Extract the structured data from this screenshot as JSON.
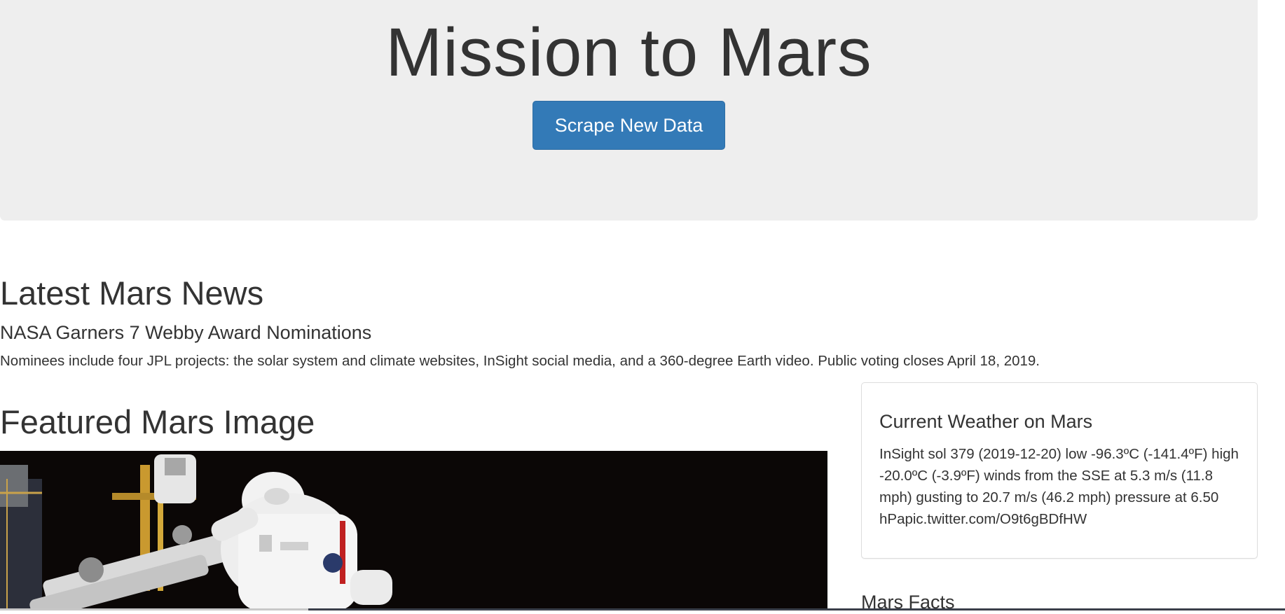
{
  "header": {
    "title": "Mission to Mars",
    "scrape_button_label": "Scrape New Data",
    "button_color": "#337ab7"
  },
  "news": {
    "heading": "Latest Mars News",
    "title": "NASA Garners 7 Webby Award Nominations",
    "paragraph": "Nominees include four JPL projects: the solar system and climate websites, InSight social media, and a 360-degree Earth video. Public voting closes April 18, 2019."
  },
  "featured": {
    "heading": "Featured Mars Image",
    "image_alt": "astronaut-spacewalk-image"
  },
  "weather": {
    "title": "Current Weather on Mars",
    "text": "InSight sol 379 (2019-12-20) low -96.3ºC (-141.4ºF) high -20.0ºC (-3.9ºF) winds from the SSE at 5.3 m/s (11.8 mph) gusting to 20.7 m/s (46.2 mph) pressure at 6.50 hPapic.twitter.com/O9t6gBDfHW"
  },
  "facts": {
    "heading": "Mars Facts"
  }
}
